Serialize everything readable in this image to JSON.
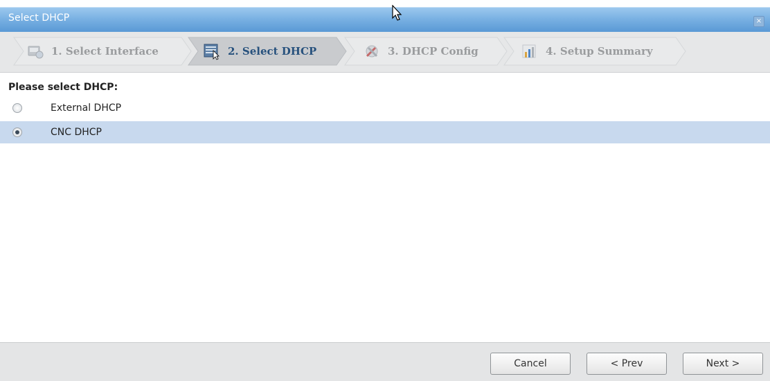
{
  "window": {
    "title": "Select DHCP",
    "close_label": "×"
  },
  "wizard": {
    "steps": [
      {
        "label": "1. Select Interface",
        "state": "inactive"
      },
      {
        "label": "2. Select DHCP",
        "state": "active"
      },
      {
        "label": "3. DHCP Config",
        "state": "inactive"
      },
      {
        "label": "4. Setup Summary",
        "state": "inactive"
      }
    ]
  },
  "content": {
    "heading": "Please select DHCP:",
    "options": [
      {
        "label": "External DHCP",
        "selected": false
      },
      {
        "label": "CNC DHCP",
        "selected": true
      }
    ]
  },
  "footer": {
    "cancel_label": "Cancel",
    "prev_label": "< Prev",
    "next_label": "Next >"
  },
  "colors": {
    "titlebar": "#78b0e2",
    "active_step_text": "#27517d",
    "selected_row": "#c8d9ee"
  }
}
